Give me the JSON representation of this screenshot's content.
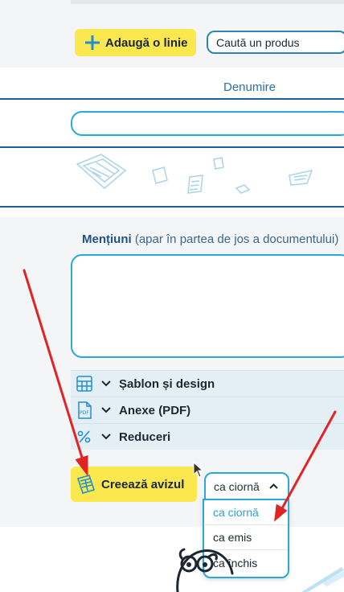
{
  "toolbar": {
    "add_line_label": "Adaugă o linie",
    "search_value": "Caută un produs"
  },
  "table": {
    "column_header": "Denumire"
  },
  "notes": {
    "label_bold": "Mențiuni",
    "label_hint": "(apar în partea de jos a documentului)"
  },
  "accordion": [
    {
      "label": "Șablon și design",
      "icon": "template-icon"
    },
    {
      "label": "Anexe (PDF)",
      "icon": "pdf-icon"
    },
    {
      "label": "Reduceri",
      "icon": "percent-icon"
    }
  ],
  "create": {
    "button_label": "Creează avizul",
    "status_selected": "ca ciornă",
    "options": [
      "ca ciornă",
      "ca emis",
      "ca închis"
    ]
  },
  "colors": {
    "accent_blue": "#2aa8d8",
    "button_yellow": "#fbe74e",
    "annotation_red": "#e02424"
  }
}
